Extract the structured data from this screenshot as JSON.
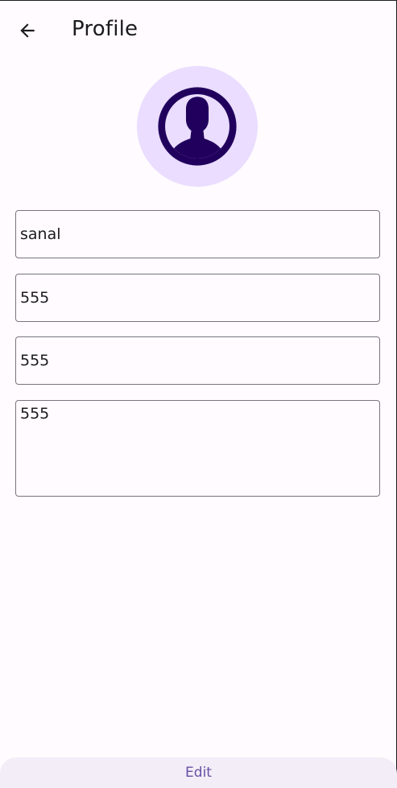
{
  "header": {
    "title": "Profile",
    "back_icon": "arrow-back-icon"
  },
  "avatar": {
    "icon": "person-silhouette-icon",
    "background": "#eaddff",
    "foreground": "#21005d"
  },
  "form": {
    "name": "sanal",
    "phone": "555",
    "phone2": "555",
    "address": "555"
  },
  "footer": {
    "edit_label": "Edit"
  },
  "colors": {
    "accent": "#6750a4",
    "outline": "#79747e"
  }
}
